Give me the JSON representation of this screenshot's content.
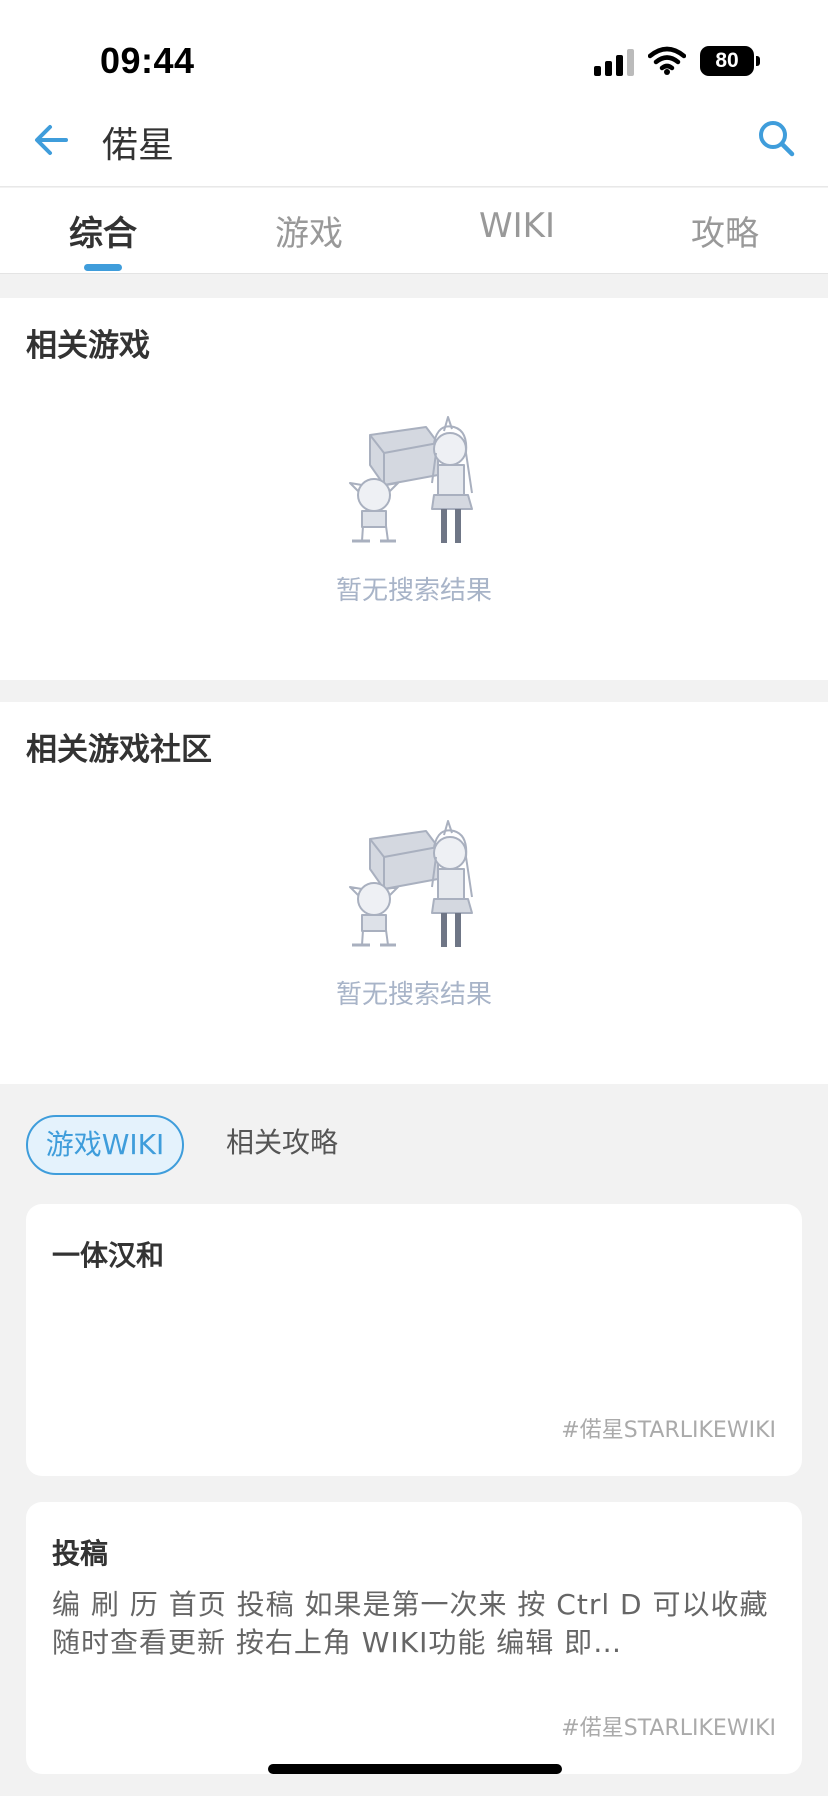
{
  "status": {
    "time": "09:44",
    "battery": "80"
  },
  "header": {
    "query": "偌星"
  },
  "tabs": [
    {
      "label": "综合",
      "active": true
    },
    {
      "label": "游戏",
      "active": false
    },
    {
      "label": "WIKI",
      "active": false
    },
    {
      "label": "攻略",
      "active": false
    }
  ],
  "sections": [
    {
      "title": "相关游戏",
      "empty_text": "暂无搜索结果"
    },
    {
      "title": "相关游戏社区",
      "empty_text": "暂无搜索结果"
    }
  ],
  "chips": [
    {
      "label": "游戏WIKI",
      "active": true
    },
    {
      "label": "相关攻略",
      "active": false
    }
  ],
  "cards": [
    {
      "title": "一体汉和",
      "body": "",
      "tag": "#偌星STARLIKEWIKI"
    },
    {
      "title": "投稿",
      "body": "编 刷 历 首页 投稿 如果是第一次来 按 Ctrl D 可以收藏随时查看更新 按右上角 WIKI功能 编辑 即…",
      "tag": "#偌星STARLIKEWIKI"
    }
  ],
  "colors": {
    "accent": "#3f9ddb",
    "empty_text": "#a8b4c8",
    "background": "#f2f2f2"
  }
}
